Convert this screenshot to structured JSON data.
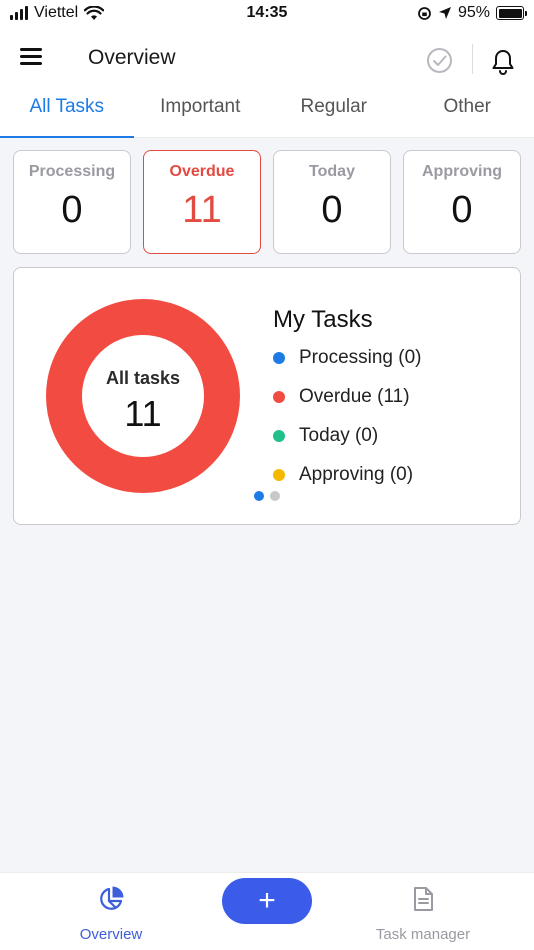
{
  "status_bar": {
    "carrier": "Viettel",
    "time": "14:35",
    "battery": "95%"
  },
  "header": {
    "title": "Overview",
    "icons": [
      "menu-icon",
      "check-circle-icon",
      "bell-icon"
    ]
  },
  "tabs": [
    {
      "label": "All Tasks",
      "active": true
    },
    {
      "label": "Important",
      "active": false
    },
    {
      "label": "Regular",
      "active": false
    },
    {
      "label": "Other",
      "active": false
    }
  ],
  "stats": [
    {
      "label": "Processing",
      "value": "0"
    },
    {
      "label": "Overdue",
      "value": "11"
    },
    {
      "label": "Today",
      "value": "0"
    },
    {
      "label": "Approving",
      "value": "0"
    }
  ],
  "chart_data": {
    "type": "pie",
    "title": "My Tasks",
    "center_label": "All tasks",
    "center_value": "11",
    "categories": [
      "Processing",
      "Overdue",
      "Today",
      "Approving"
    ],
    "values": [
      0,
      11,
      0,
      0
    ],
    "legend": [
      "Processing (0)",
      "Overdue (11)",
      "Today (0)",
      "Approving (0)"
    ],
    "colors": [
      "#1e7be6",
      "#f24c42",
      "#22c08a",
      "#f5b800"
    ],
    "legend_placement": "right"
  },
  "colors": {
    "accent": "#1e7be6",
    "overdue": "#e24b42",
    "fab": "#3b5ce8",
    "nav_active": "#3d5fd9"
  },
  "bottom_nav": {
    "overview_label": "Overview",
    "add_label": "+",
    "task_manager_label": "Task manager"
  }
}
